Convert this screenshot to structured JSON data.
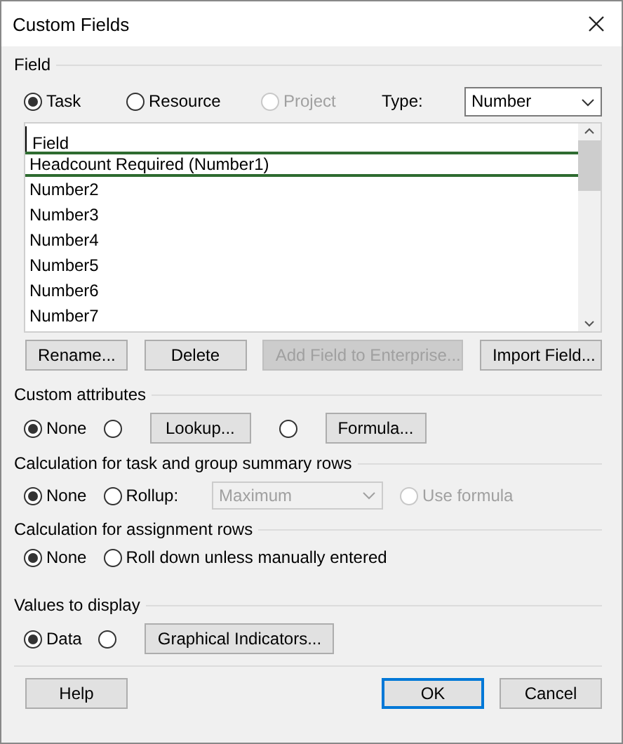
{
  "window": {
    "title": "Custom Fields"
  },
  "field_section": {
    "title": "Field",
    "scope": [
      {
        "label": "Task",
        "selected": true,
        "disabled": false
      },
      {
        "label": "Resource",
        "selected": false,
        "disabled": false
      },
      {
        "label": "Project",
        "selected": false,
        "disabled": true
      }
    ],
    "type": {
      "label": "Type:",
      "value": "Number"
    },
    "table": {
      "column": "Field",
      "rows": [
        {
          "label": "Headcount Required (Number1)",
          "selected": true
        },
        {
          "label": "Number2",
          "selected": false
        },
        {
          "label": "Number3",
          "selected": false
        },
        {
          "label": "Number4",
          "selected": false
        },
        {
          "label": "Number5",
          "selected": false
        },
        {
          "label": "Number6",
          "selected": false
        },
        {
          "label": "Number7",
          "selected": false
        }
      ]
    },
    "buttons": [
      {
        "label": "Rename...",
        "disabled": false
      },
      {
        "label": "Delete",
        "disabled": false
      },
      {
        "label": "Add Field to Enterprise...",
        "disabled": true
      },
      {
        "label": "Import Field...",
        "disabled": false
      }
    ]
  },
  "sections": [
    {
      "title": "Custom attributes",
      "items": [
        {
          "kind": "radio",
          "label": "None",
          "selected": true,
          "disabled": false
        },
        {
          "kind": "radio",
          "selected": false,
          "disabled": false
        },
        {
          "kind": "button",
          "label": "Lookup..."
        },
        {
          "kind": "radio",
          "selected": false,
          "disabled": false
        },
        {
          "kind": "button",
          "label": "Formula..."
        }
      ]
    },
    {
      "title": "Calculation for task and group summary rows",
      "items": [
        {
          "kind": "radio",
          "label": "None",
          "selected": true,
          "disabled": false
        },
        {
          "kind": "radio",
          "label": "Rollup:",
          "selected": false,
          "disabled": false
        },
        {
          "kind": "select",
          "value": "Maximum",
          "disabled": true
        },
        {
          "kind": "radio",
          "label": "Use formula",
          "selected": false,
          "disabled": true
        }
      ]
    },
    {
      "title": "Calculation for assignment rows",
      "items": [
        {
          "kind": "radio",
          "label": "None",
          "selected": true,
          "disabled": false
        },
        {
          "kind": "radio",
          "label": "Roll down unless manually entered",
          "selected": false,
          "disabled": false
        }
      ]
    },
    {
      "title": "Values to display",
      "items": [
        {
          "kind": "radio",
          "label": "Data",
          "selected": true,
          "disabled": false
        },
        {
          "kind": "radio",
          "selected": false,
          "disabled": false
        },
        {
          "kind": "button",
          "label": "Graphical Indicators..."
        }
      ]
    }
  ],
  "footer": [
    {
      "label": "Help",
      "default": false
    },
    {
      "label": "OK",
      "default": true
    },
    {
      "label": "Cancel",
      "default": false
    }
  ]
}
